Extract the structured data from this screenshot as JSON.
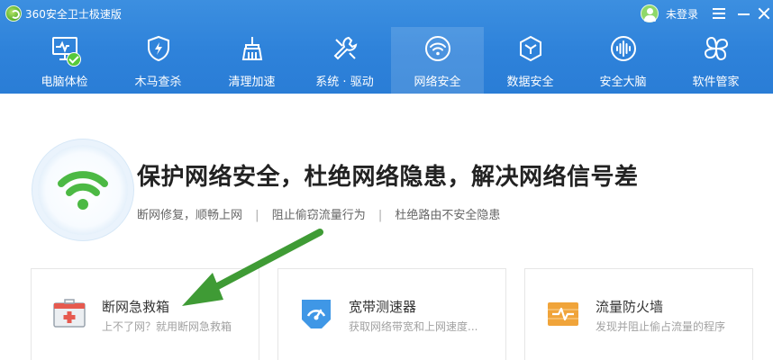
{
  "window": {
    "title": "360安全卫士极速版",
    "user_label": "未登录"
  },
  "tabs": [
    {
      "label": "电脑体检",
      "icon": "monitor-icon"
    },
    {
      "label": "木马查杀",
      "icon": "shield-bolt-icon"
    },
    {
      "label": "清理加速",
      "icon": "broom-icon"
    },
    {
      "label": "系统 · 驱动",
      "icon": "wrench-icon"
    },
    {
      "label": "网络安全",
      "icon": "wifi-icon",
      "active": true
    },
    {
      "label": "数据安全",
      "icon": "hexagon-icon"
    },
    {
      "label": "安全大脑",
      "icon": "waveform-icon"
    },
    {
      "label": "软件管家",
      "icon": "clover-icon"
    }
  ],
  "hero": {
    "title": "保护网络安全，杜绝网络隐患，解决网络信号差",
    "features": [
      "断网修复，顺畅上网",
      "阻止偷窃流量行为",
      "杜绝路由不安全隐患"
    ],
    "separator": "|"
  },
  "cards": [
    {
      "title": "断网急救箱",
      "desc": "上不了网？就用断网急救箱",
      "icon": "first-aid-kit-icon"
    },
    {
      "title": "宽带测速器",
      "desc": "获取网络带宽和上网速度...",
      "icon": "speedometer-icon"
    },
    {
      "title": "流量防火墙",
      "desc": "发现并阻止偷占流量的程序",
      "icon": "firewall-icon"
    }
  ],
  "colors": {
    "header_blue": "#2e82da",
    "accent_green": "#4caf3c",
    "arrow_green": "#3f9b35",
    "title_text": "#222222",
    "sub_text": "#666666"
  }
}
